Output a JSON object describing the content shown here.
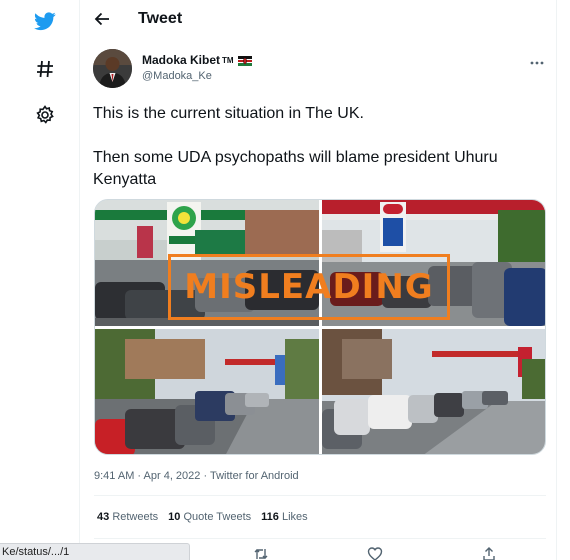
{
  "header": {
    "title": "Tweet"
  },
  "author": {
    "name": "Madoka Kibet",
    "tm": "TM",
    "handle": "@Madoka_Ke"
  },
  "tweet": {
    "line1": "This is the current situation in The UK.",
    "line2": "Then some UDA psychopaths will blame president Uhuru Kenyatta"
  },
  "media": {
    "overlay_label": "MISLEADING"
  },
  "meta": {
    "timestamp": "9:41 AM · Apr 4, 2022 · Twitter for Android"
  },
  "stats": {
    "retweets_count": "43",
    "retweets_label": "Retweets",
    "quotes_count": "10",
    "quotes_label": "Quote Tweets",
    "likes_count": "116",
    "likes_label": "Likes"
  },
  "status_bar": {
    "url": "Ke/status/.../1"
  },
  "colors": {
    "twitter_blue": "#1d9bf0",
    "misleading_orange": "#f07e1f"
  },
  "icons": [
    "twitter-bird-icon",
    "hashtag-icon",
    "gear-icon",
    "back-arrow-icon",
    "more-icon",
    "reply-icon",
    "retweet-icon",
    "like-icon",
    "share-icon"
  ]
}
